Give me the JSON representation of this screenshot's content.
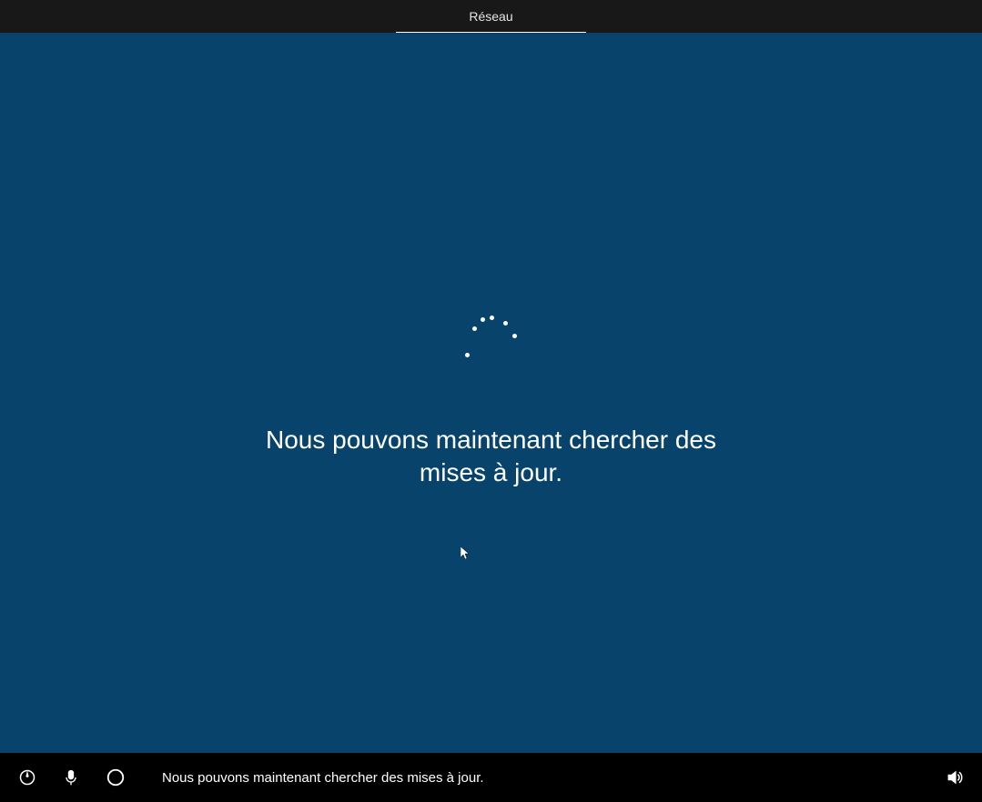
{
  "top_bar": {
    "tab_label": "Réseau"
  },
  "main": {
    "message": "Nous pouvons maintenant chercher des mises à jour."
  },
  "bottom_bar": {
    "caption": "Nous pouvons maintenant chercher des mises à jour."
  }
}
